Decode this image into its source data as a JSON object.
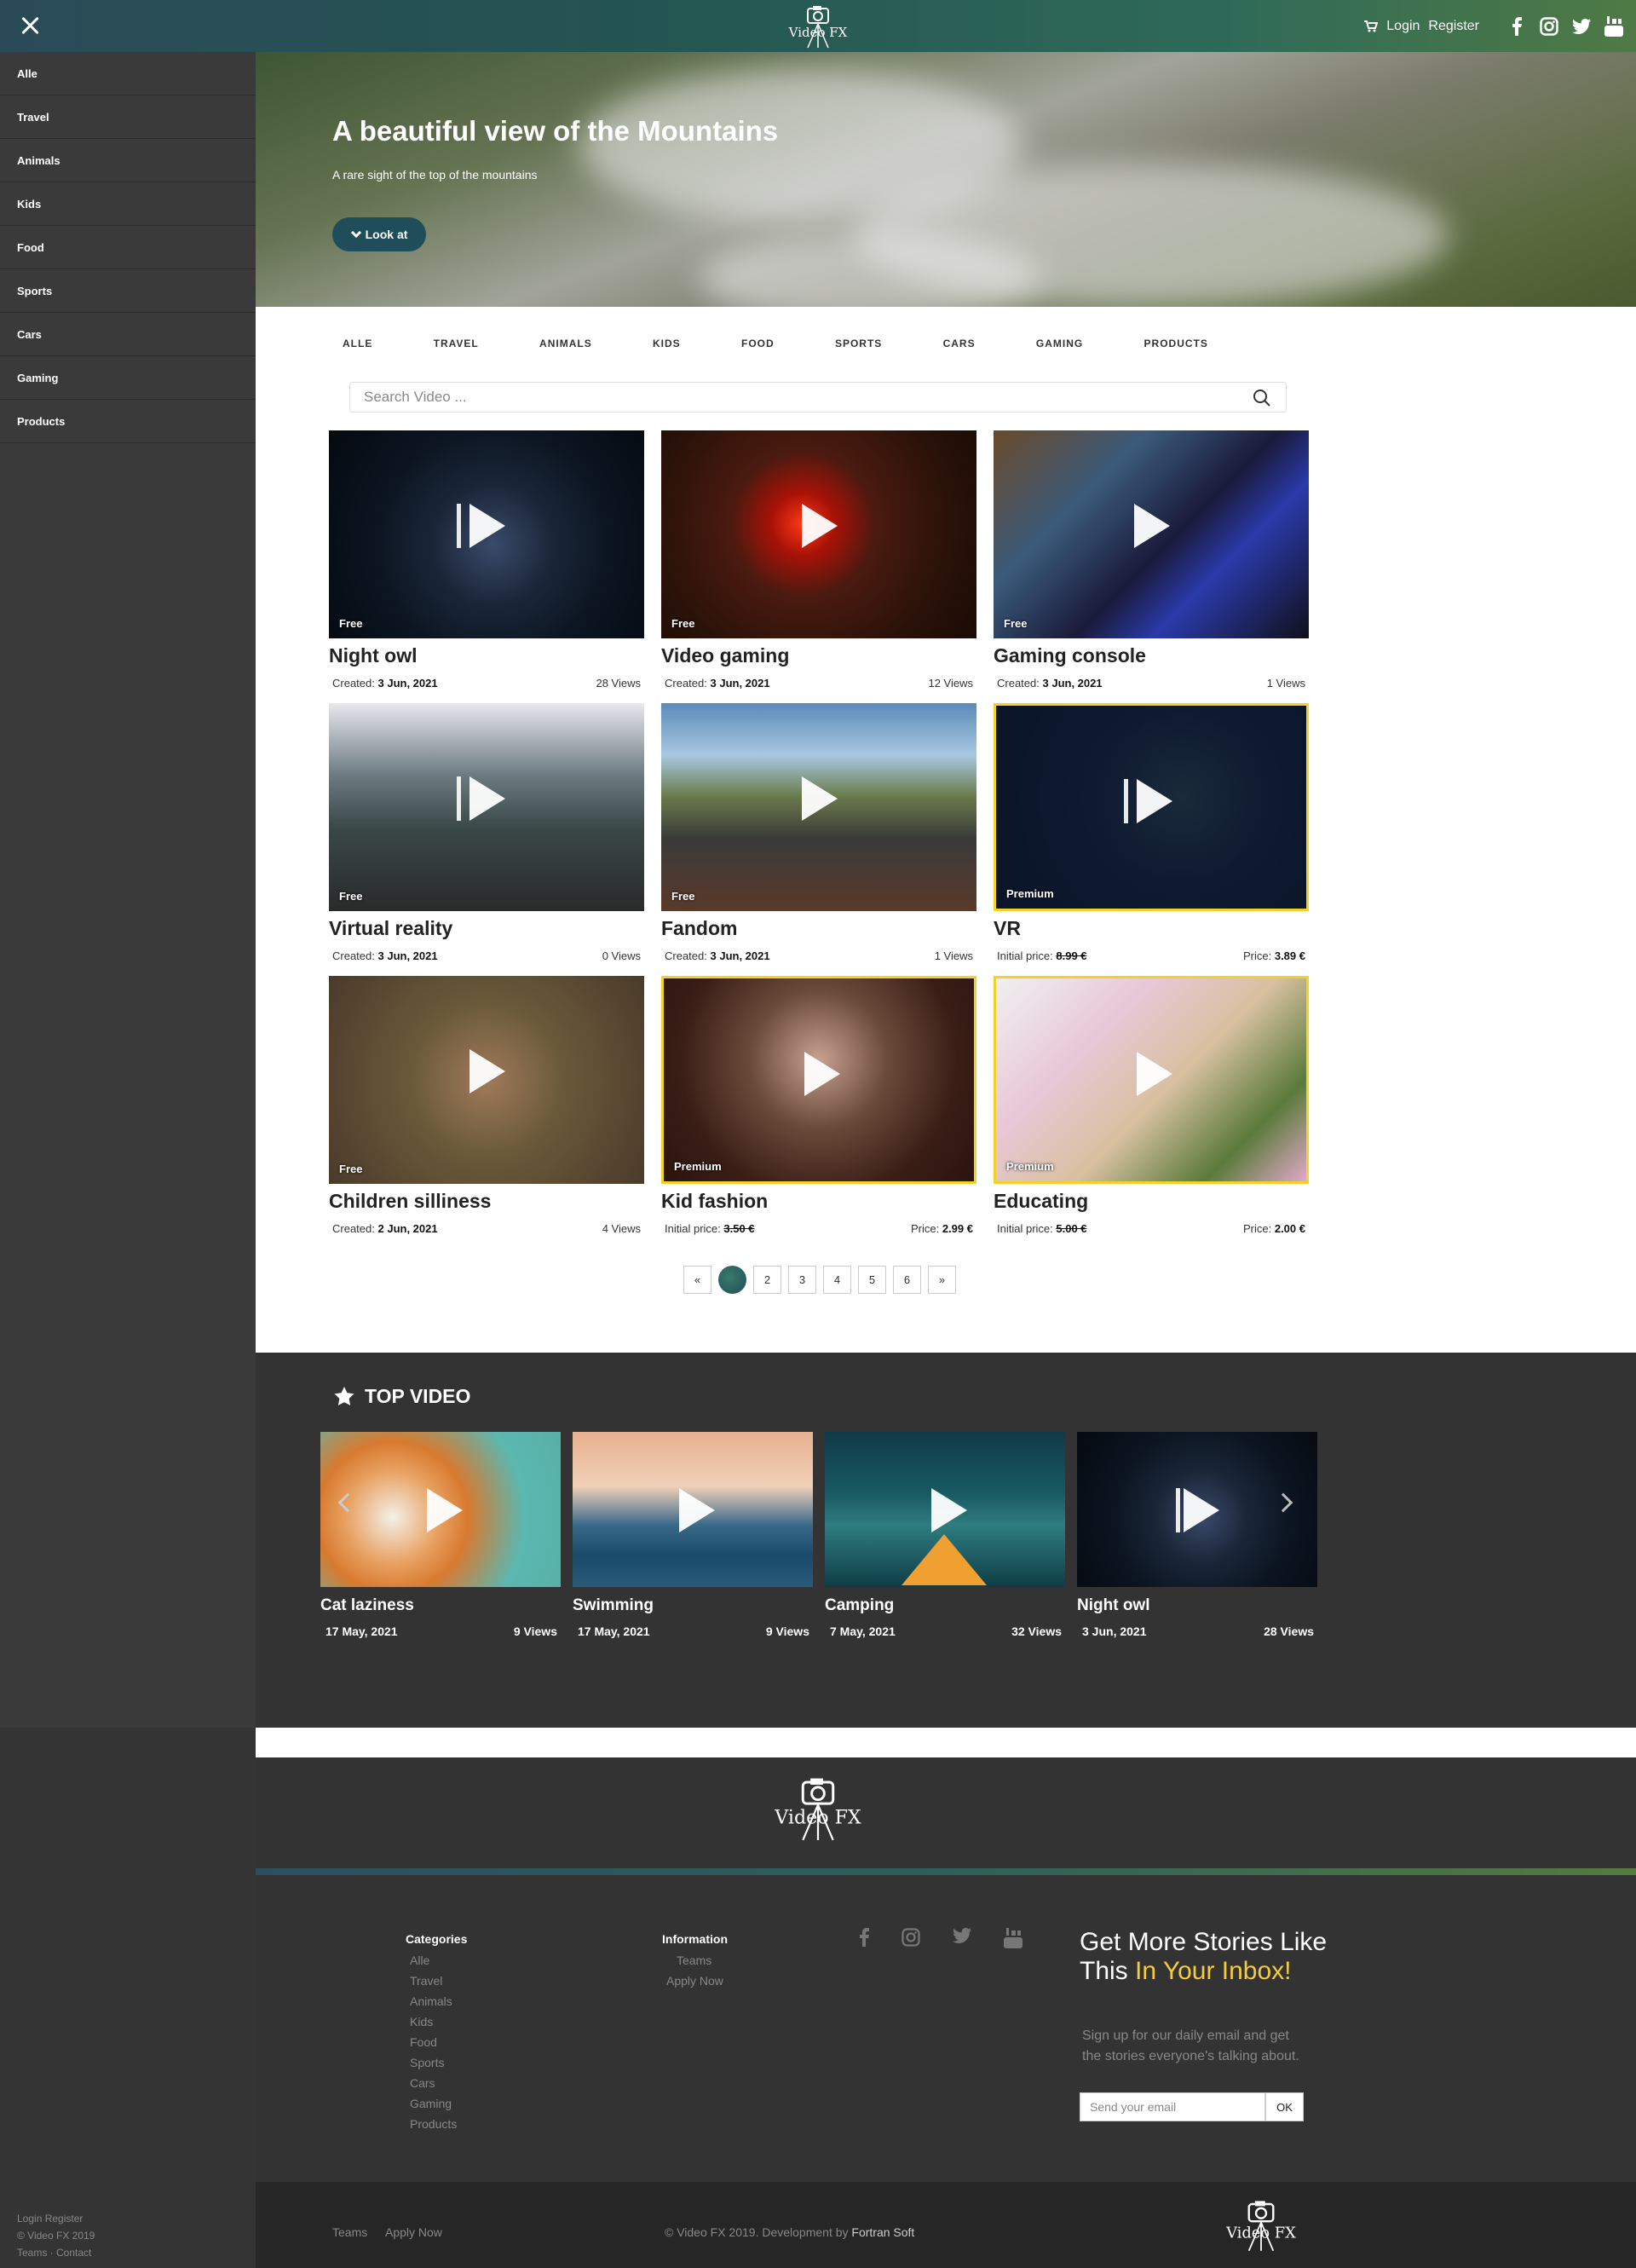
{
  "brand": {
    "logo_text": "Video FX"
  },
  "topbar": {
    "login": "Login",
    "register": "Register"
  },
  "sidebar": {
    "items": [
      "Alle",
      "Travel",
      "Animals",
      "Kids",
      "Food",
      "Sports",
      "Cars",
      "Gaming",
      "Products"
    ]
  },
  "hero": {
    "title": "A beautiful view of the Mountains",
    "subtitle": "A rare sight of the top of the mountains",
    "button": "Look at"
  },
  "categories": [
    "ALLE",
    "TRAVEL",
    "ANIMALS",
    "KIDS",
    "FOOD",
    "SPORTS",
    "CARS",
    "GAMING",
    "PRODUCTS"
  ],
  "search": {
    "placeholder": "Search Video ..."
  },
  "videos": [
    {
      "title": "Night owl",
      "badge": "Free",
      "created_label": "Created:",
      "created": "3 Jun, 2021",
      "views": "28 Views"
    },
    {
      "title": "Video gaming",
      "badge": "Free",
      "created_label": "Created:",
      "created": "3 Jun, 2021",
      "views": "12 Views"
    },
    {
      "title": "Gaming console",
      "badge": "Free",
      "created_label": "Created:",
      "created": "3 Jun, 2021",
      "views": "1 Views"
    },
    {
      "title": "Virtual reality",
      "badge": "Free",
      "created_label": "Created:",
      "created": "3 Jun, 2021",
      "views": "0 Views"
    },
    {
      "title": "Fandom",
      "badge": "Free",
      "created_label": "Created:",
      "created": "3 Jun, 2021",
      "views": "1 Views"
    },
    {
      "title": "VR",
      "badge": "Premium",
      "initial_label": "Initial price:",
      "initial_price": "8.99 €",
      "price_label": "Price:",
      "price": "3.89 €"
    },
    {
      "title": "Children silliness",
      "badge": "Free",
      "created_label": "Created:",
      "created": "2 Jun, 2021",
      "views": "4 Views"
    },
    {
      "title": "Kid fashion",
      "badge": "Premium",
      "initial_label": "Initial price:",
      "initial_price": "3.50 €",
      "price_label": "Price:",
      "price": "2.99 €"
    },
    {
      "title": "Educating",
      "badge": "Premium",
      "initial_label": "Initial price:",
      "initial_price": "5.00 €",
      "price_label": "Price:",
      "price": "2.00 €"
    }
  ],
  "pagination": {
    "prev": "«",
    "next": "»",
    "pages": [
      "",
      "2",
      "3",
      "4",
      "5",
      "6"
    ]
  },
  "top_video": {
    "heading": "TOP VIDEO",
    "items": [
      {
        "title": "Cat laziness",
        "date": "17 May, 2021",
        "views": "9 Views"
      },
      {
        "title": "Swimming",
        "date": "17 May, 2021",
        "views": "9 Views"
      },
      {
        "title": "Camping",
        "date": "7 May, 2021",
        "views": "32 Views"
      },
      {
        "title": "Night owl",
        "date": "3 Jun, 2021",
        "views": "28 Views"
      }
    ]
  },
  "footer": {
    "categories_heading": "Categories",
    "categories": [
      "Alle",
      "Travel",
      "Animals",
      "Kids",
      "Food",
      "Sports",
      "Cars",
      "Gaming",
      "Products"
    ],
    "information_heading": "Information",
    "information": [
      "Teams",
      "Apply Now"
    ],
    "newsletter_title_a": "Get More Stories Like This ",
    "newsletter_title_b": "In Your Inbox!",
    "newsletter_sub": "Sign up for our daily email and get the stories everyone's talking about.",
    "email_placeholder": "Send your email",
    "ok": "OK"
  },
  "bottom": {
    "teams": "Teams",
    "apply": "Apply Now",
    "copyright": "© Video FX 2019. Development by ",
    "dev": "Fortran Soft"
  },
  "sidebar_footer": {
    "login": "Login",
    "register": "Register",
    "copyright": "© Video FX 2019",
    "teams": "Teams",
    "contact": "Contact"
  },
  "colors": {
    "accent": "#1f4e5a",
    "premium": "#f2d22a",
    "newsletter_highlight": "#f5cd3c"
  }
}
